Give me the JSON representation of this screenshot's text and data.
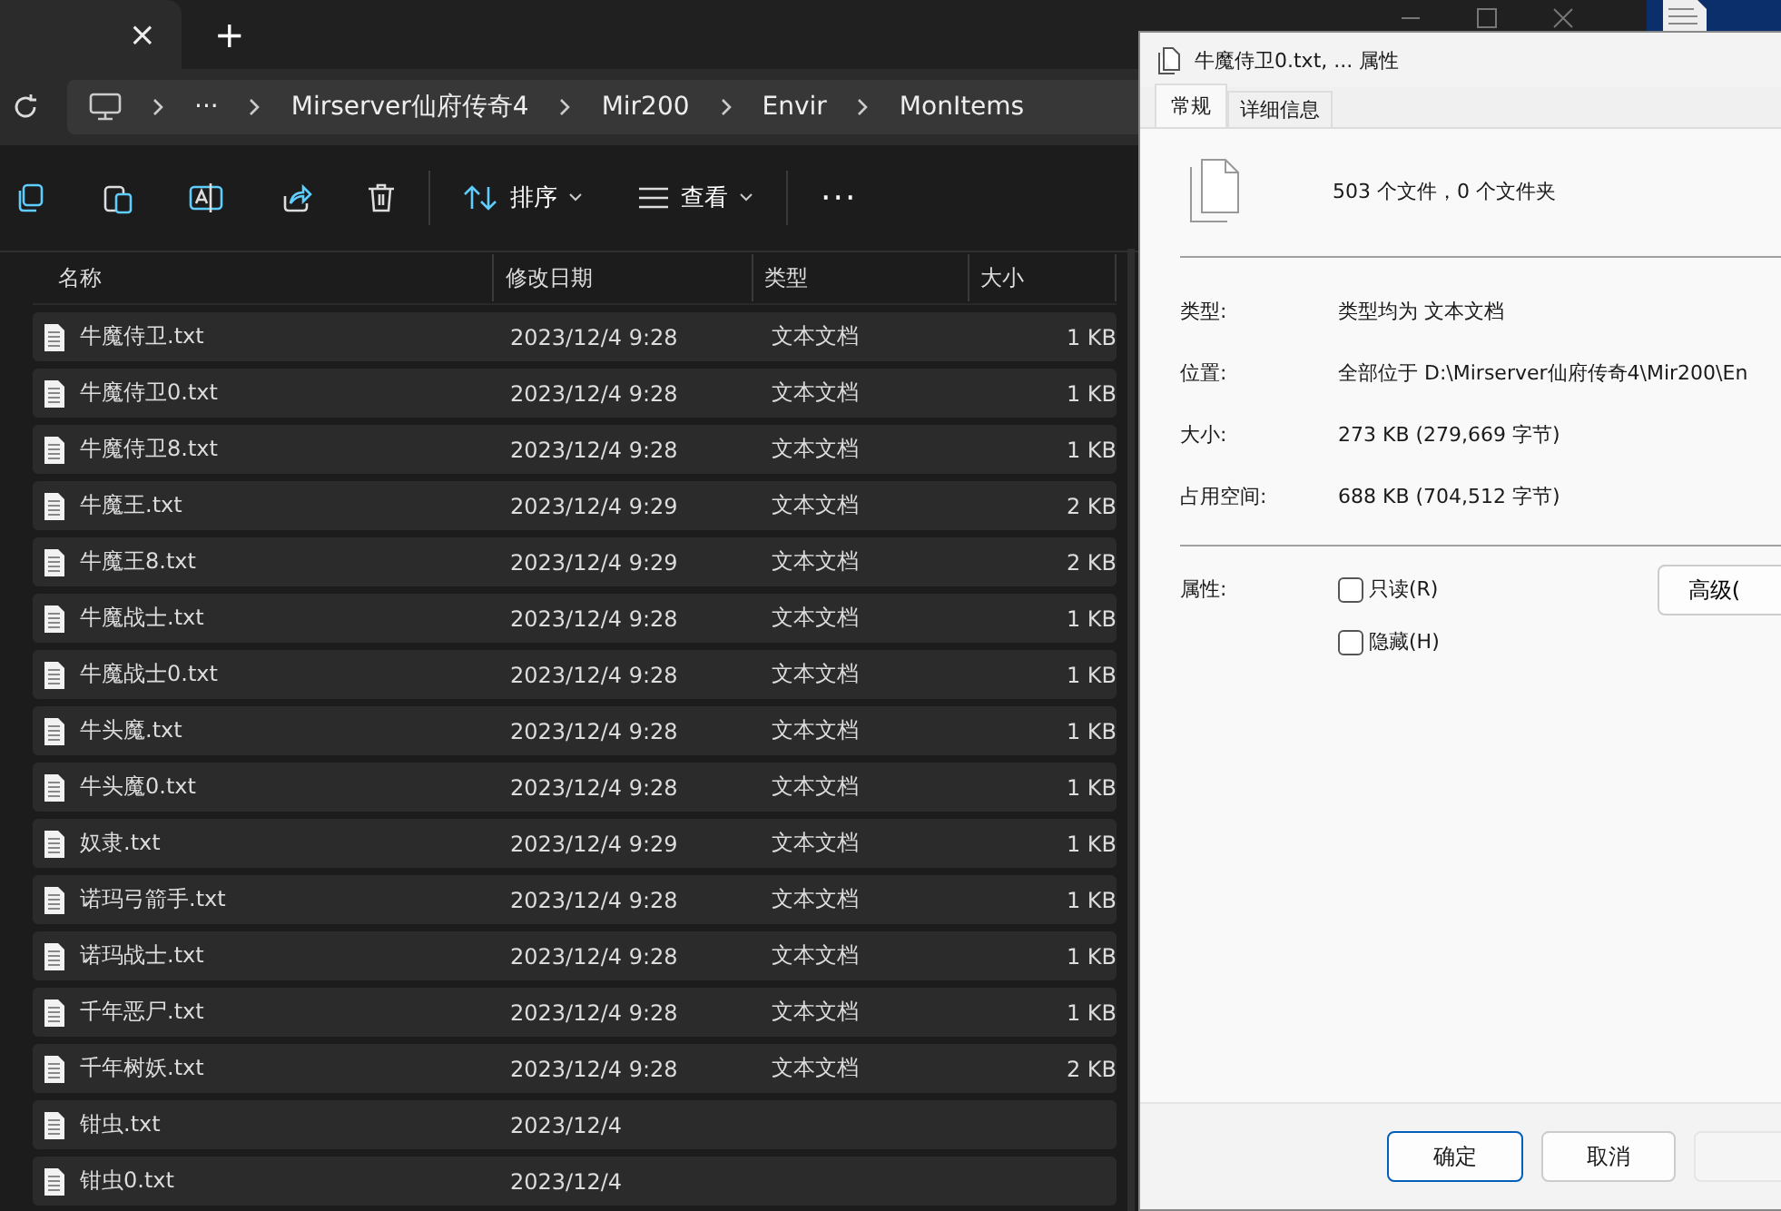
{
  "explorer": {
    "tab_close": "×",
    "new_tab": "+",
    "breadcrumb": [
      "Mirserver仙府传奇4",
      "Mir200",
      "Envir",
      "MonItems"
    ],
    "breadcrumb_overflow": "···",
    "toolbar": {
      "sort": "排序",
      "view": "查看",
      "more": "···"
    },
    "columns": [
      "名称",
      "修改日期",
      "类型",
      "大小"
    ],
    "rows": [
      {
        "name": "牛魔侍卫.txt",
        "date": "2023/12/4 9:28",
        "type": "文本文档",
        "size": "1 KB"
      },
      {
        "name": "牛魔侍卫0.txt",
        "date": "2023/12/4 9:28",
        "type": "文本文档",
        "size": "1 KB"
      },
      {
        "name": "牛魔侍卫8.txt",
        "date": "2023/12/4 9:28",
        "type": "文本文档",
        "size": "1 KB"
      },
      {
        "name": "牛魔王.txt",
        "date": "2023/12/4 9:29",
        "type": "文本文档",
        "size": "2 KB"
      },
      {
        "name": "牛魔王8.txt",
        "date": "2023/12/4 9:29",
        "type": "文本文档",
        "size": "2 KB"
      },
      {
        "name": "牛魔战士.txt",
        "date": "2023/12/4 9:28",
        "type": "文本文档",
        "size": "1 KB"
      },
      {
        "name": "牛魔战士0.txt",
        "date": "2023/12/4 9:28",
        "type": "文本文档",
        "size": "1 KB"
      },
      {
        "name": "牛头魔.txt",
        "date": "2023/12/4 9:28",
        "type": "文本文档",
        "size": "1 KB"
      },
      {
        "name": "牛头魔0.txt",
        "date": "2023/12/4 9:28",
        "type": "文本文档",
        "size": "1 KB"
      },
      {
        "name": "奴隶.txt",
        "date": "2023/12/4 9:29",
        "type": "文本文档",
        "size": "1 KB"
      },
      {
        "name": "诺玛弓箭手.txt",
        "date": "2023/12/4 9:28",
        "type": "文本文档",
        "size": "1 KB"
      },
      {
        "name": "诺玛战士.txt",
        "date": "2023/12/4 9:28",
        "type": "文本文档",
        "size": "1 KB"
      },
      {
        "name": "千年恶尸.txt",
        "date": "2023/12/4 9:28",
        "type": "文本文档",
        "size": "1 KB"
      },
      {
        "name": "千年树妖.txt",
        "date": "2023/12/4 9:28",
        "type": "文本文档",
        "size": "2 KB"
      },
      {
        "name": "钳虫.txt",
        "date": "2023/12/4"
      },
      {
        "name": "钳虫0.txt",
        "date": "2023/12/4"
      }
    ]
  },
  "dialog": {
    "title": "牛魔侍卫0.txt, ... 属性",
    "tabs": [
      {
        "label": "常规",
        "selected": true
      },
      {
        "label": "详细信息",
        "selected": false
      }
    ],
    "summary": "503 个文件，0 个文件夹",
    "fields": [
      {
        "label": "类型:",
        "value": "类型均为 文本文档"
      },
      {
        "label": "位置:",
        "value": "全部位于 D:\\Mirserver仙府传奇4\\Mir200\\En"
      },
      {
        "label": "大小:",
        "value": "273 KB (279,669 字节)"
      },
      {
        "label": "占用空间:",
        "value": "688 KB (704,512 字节)"
      }
    ],
    "attributes_label": "属性:",
    "attributes": [
      {
        "label": "只读(R)",
        "checked": false
      },
      {
        "label": "隐藏(H)",
        "checked": false
      }
    ],
    "advanced_button": "高级(",
    "buttons": [
      {
        "label": "确定",
        "kind": "default"
      },
      {
        "label": "取消",
        "kind": "normal"
      },
      {
        "kind": "disabled"
      }
    ]
  }
}
